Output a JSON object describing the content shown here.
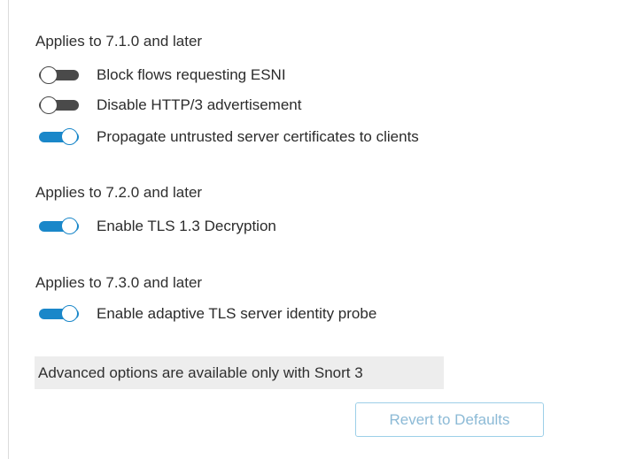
{
  "sections": [
    {
      "heading": "Applies to 7.1.0 and later",
      "options": [
        {
          "label": "Block flows requesting ESNI",
          "enabled": false
        },
        {
          "label": "Disable HTTP/3 advertisement",
          "enabled": false
        },
        {
          "label": "Propagate untrusted server certificates to clients",
          "enabled": true
        }
      ]
    },
    {
      "heading": "Applies to 7.2.0 and later",
      "options": [
        {
          "label": "Enable TLS 1.3 Decryption",
          "enabled": true
        }
      ]
    },
    {
      "heading": "Applies to 7.3.0 and later",
      "options": [
        {
          "label": "Enable adaptive TLS server identity probe",
          "enabled": true
        }
      ]
    }
  ],
  "notice": "Advanced options are available only with Snort 3",
  "revert_button": {
    "label": "Revert to Defaults",
    "disabled": true
  },
  "colors": {
    "toggle_on": "#1a87c9",
    "toggle_off": "#4a4a4a",
    "notice_bg": "#ededed",
    "button_border": "#9dcfe8",
    "button_text": "#8cbad6"
  }
}
